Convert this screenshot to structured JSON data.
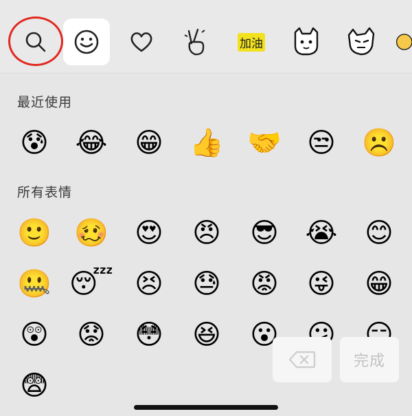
{
  "tabs": [
    {
      "id": "search",
      "icon": "search-icon"
    },
    {
      "id": "emoji",
      "icon": "smiley-icon",
      "active": true
    },
    {
      "id": "favorites",
      "icon": "heart-icon"
    },
    {
      "id": "gesture",
      "icon": "peace-hand-icon"
    },
    {
      "id": "sticker-jiayou",
      "label": "加油"
    },
    {
      "id": "sticker-cat-1",
      "icon": "cat-sticker-icon"
    },
    {
      "id": "sticker-cat-2",
      "icon": "cat-sticker-icon"
    },
    {
      "id": "sticker-more",
      "icon": "partial-sticker-icon"
    }
  ],
  "sections": {
    "recent": {
      "title": "最近使用",
      "items": [
        "😰",
        "😂",
        "😁",
        "👍",
        "🤝",
        "😒",
        "☹️"
      ]
    },
    "all": {
      "title": "所有表情",
      "items": [
        "🙂",
        "🥴",
        "😍",
        "😠",
        "😎",
        "😭",
        "😊",
        "🤐",
        "😴",
        "😣",
        "😓",
        "😡",
        "😜",
        "😁",
        "😲",
        "😟",
        "😳",
        "😆",
        "😮",
        "😕",
        "😑",
        "😨"
      ]
    }
  },
  "actions": {
    "delete_icon": "backspace-icon",
    "done_label": "完成"
  },
  "colors": {
    "background": "#e6e6e6",
    "selection_ring": "#e0281f",
    "active_tab": "#ffffff"
  }
}
